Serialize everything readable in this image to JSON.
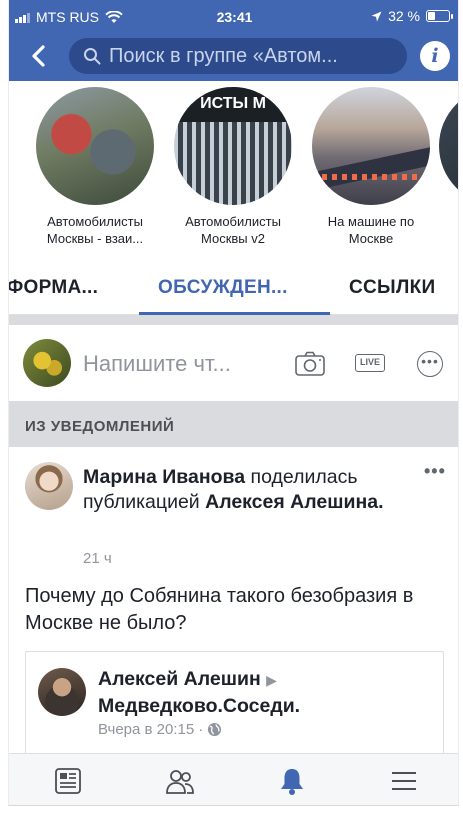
{
  "status_bar": {
    "carrier": "MTS RUS",
    "time": "23:41",
    "battery": "32 %"
  },
  "nav": {
    "search_placeholder": "Поиск в группе «Автом..."
  },
  "groups": [
    {
      "name_line1": "Автомобилисты",
      "name_line2": "Москвы - взаи..."
    },
    {
      "name_line1": "Автомобилисты",
      "name_line2": "Москвы v2",
      "image_text": "ИСТЫ М"
    },
    {
      "name_line1": "На машине по",
      "name_line2": "Москве"
    }
  ],
  "tabs": [
    {
      "label": "ФОРМА..."
    },
    {
      "label": "ОБСУЖДЕН...",
      "active": true
    },
    {
      "label": "ССЫЛКИ"
    }
  ],
  "composer": {
    "placeholder": "Напишите чт...",
    "live_label": "LIVE"
  },
  "section": {
    "title": "ИЗ УВЕДОМЛЕНИЙ"
  },
  "post": {
    "author": "Марина Иванова",
    "action": "поделилась публикацией",
    "source_author": "Алексея Алешина",
    "time": "21 ч",
    "text": "Почему до Собянина такого безобразия в Москве не было?",
    "shared": {
      "author": "Алексей Алешин",
      "group": "Медведково.Соседи.",
      "time": "Вчера в 20:15"
    }
  },
  "colors": {
    "brand": "#4267b2",
    "divider": "#d9dbde"
  }
}
